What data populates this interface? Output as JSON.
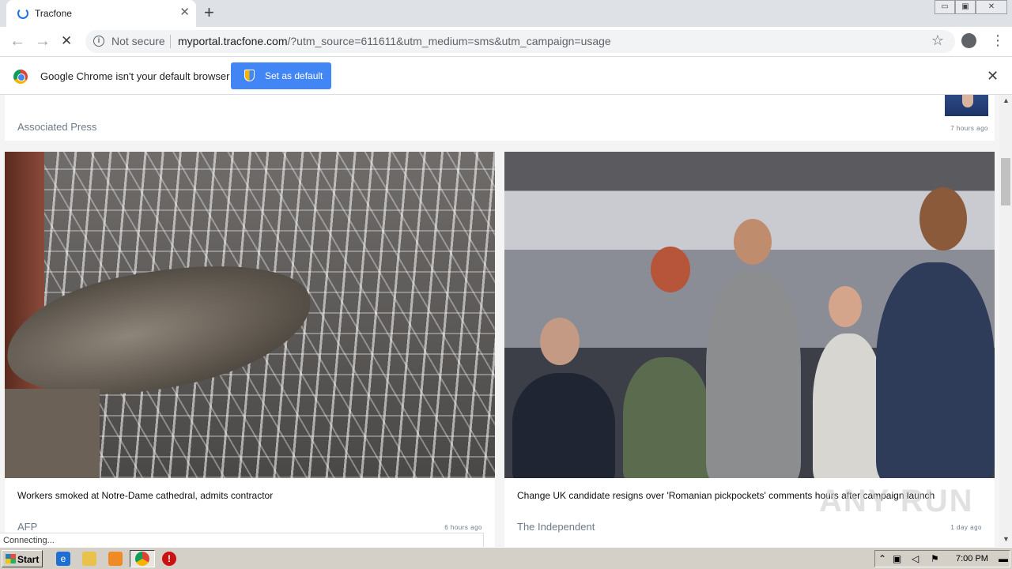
{
  "browser": {
    "tab_title": "Tracfone",
    "tab_close": "✕",
    "new_tab": "+",
    "window_controls": [
      "▭",
      "▣",
      "✕"
    ],
    "back": "←",
    "forward": "→",
    "reload": "✕",
    "security_label": "Not secure",
    "url_host": "myportal.tracfone.com",
    "url_rest": "/?utm_source=611611&utm_medium=sms&utm_campaign=usage",
    "bookmark": "☆",
    "menu": "⋮"
  },
  "infobar": {
    "message": "Google Chrome isn't your default browser",
    "button": "Set as default",
    "close": "✕"
  },
  "feed": {
    "top_card": {
      "source": "Associated Press",
      "time": "7 hours ago"
    },
    "cards": [
      {
        "headline": "Workers smoked at Notre-Dame cathedral, admits contractor",
        "source": "AFP",
        "time": "6 hours ago"
      },
      {
        "headline": "Change UK candidate resigns over 'Romanian pickpockets' comments hours after campaign launch",
        "source": "The Independent",
        "time": "1 day ago"
      }
    ]
  },
  "status": {
    "text": "Connecting..."
  },
  "watermark": "ANY RUN",
  "taskbar": {
    "start": "Start",
    "clock": "7:00 PM"
  }
}
